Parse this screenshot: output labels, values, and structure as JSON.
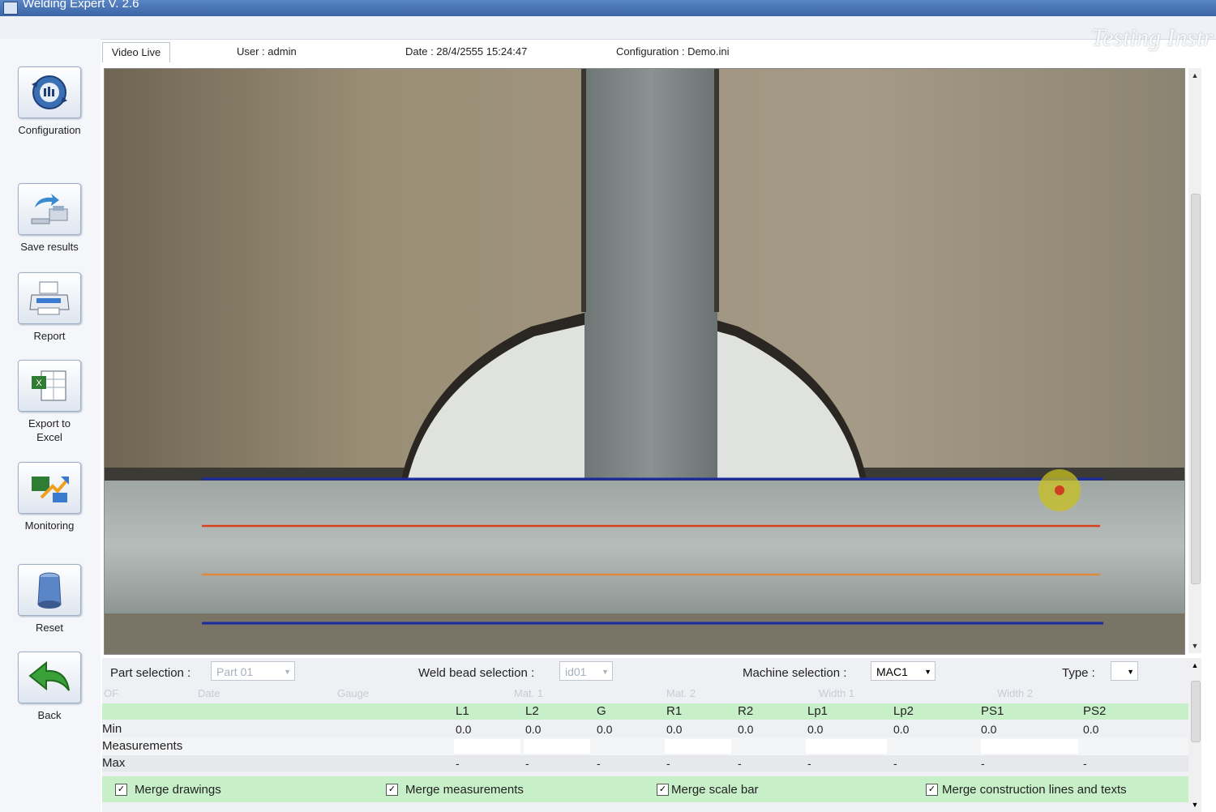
{
  "window": {
    "title": "Welding Expert V. 2.6"
  },
  "watermark": "Testing Instr",
  "sidebar": {
    "items": [
      {
        "label": "Configuration",
        "icon": "configuration-icon"
      },
      {
        "label": "Save results",
        "icon": "save-results-icon"
      },
      {
        "label": "Report",
        "icon": "printer-icon"
      },
      {
        "label_line1": "Export to",
        "label_line2": "Excel",
        "icon": "excel-icon"
      },
      {
        "label": "Monitoring",
        "icon": "monitoring-icon"
      },
      {
        "label": "Reset",
        "icon": "reset-cylinder-icon"
      },
      {
        "label": "Back",
        "icon": "back-arrow-icon"
      }
    ]
  },
  "header": {
    "tab": "Video Live",
    "user": "User : admin",
    "date": "Date : 28/4/2555 15:24:47",
    "configuration": "Configuration : Demo.ini"
  },
  "selection": {
    "part_label": "Part selection :",
    "part_value": "Part 01",
    "weld_label": "Weld bead selection :",
    "weld_value": "id01",
    "machine_label": "Machine selection :",
    "machine_value": "MAC1",
    "type_label": "Type :",
    "type_value": ""
  },
  "ghost_headers": [
    "OF",
    "Date",
    "Gauge",
    "Mat. 1",
    "Mat. 2",
    "Width 1",
    "Width 2"
  ],
  "table": {
    "columns": [
      "L1",
      "L2",
      "G",
      "R1",
      "R2",
      "Lp1",
      "Lp2",
      "PS1",
      "PS2"
    ],
    "rows": [
      {
        "label": "Min",
        "values": [
          "0.0",
          "0.0",
          "0.0",
          "0.0",
          "0.0",
          "0.0",
          "0.0",
          "0.0",
          "0.0"
        ]
      },
      {
        "label": "Measurements",
        "values": [
          "",
          "",
          "",
          "",
          "",
          "",
          "",
          "",
          ""
        ]
      },
      {
        "label": "Max",
        "values": [
          "-",
          "-",
          "-",
          "-",
          "-",
          "-",
          "-",
          "-",
          "-"
        ]
      }
    ]
  },
  "merge": [
    {
      "label": "Merge drawings",
      "checked": true
    },
    {
      "label": "Merge measurements",
      "checked": true
    },
    {
      "label": "Merge scale bar",
      "checked": true
    },
    {
      "label": "Merge construction lines and texts",
      "checked": true
    }
  ],
  "overlay_colors": {
    "blue": "#1a2aa0",
    "red": "#d8401c",
    "orange": "#e08a3c"
  }
}
